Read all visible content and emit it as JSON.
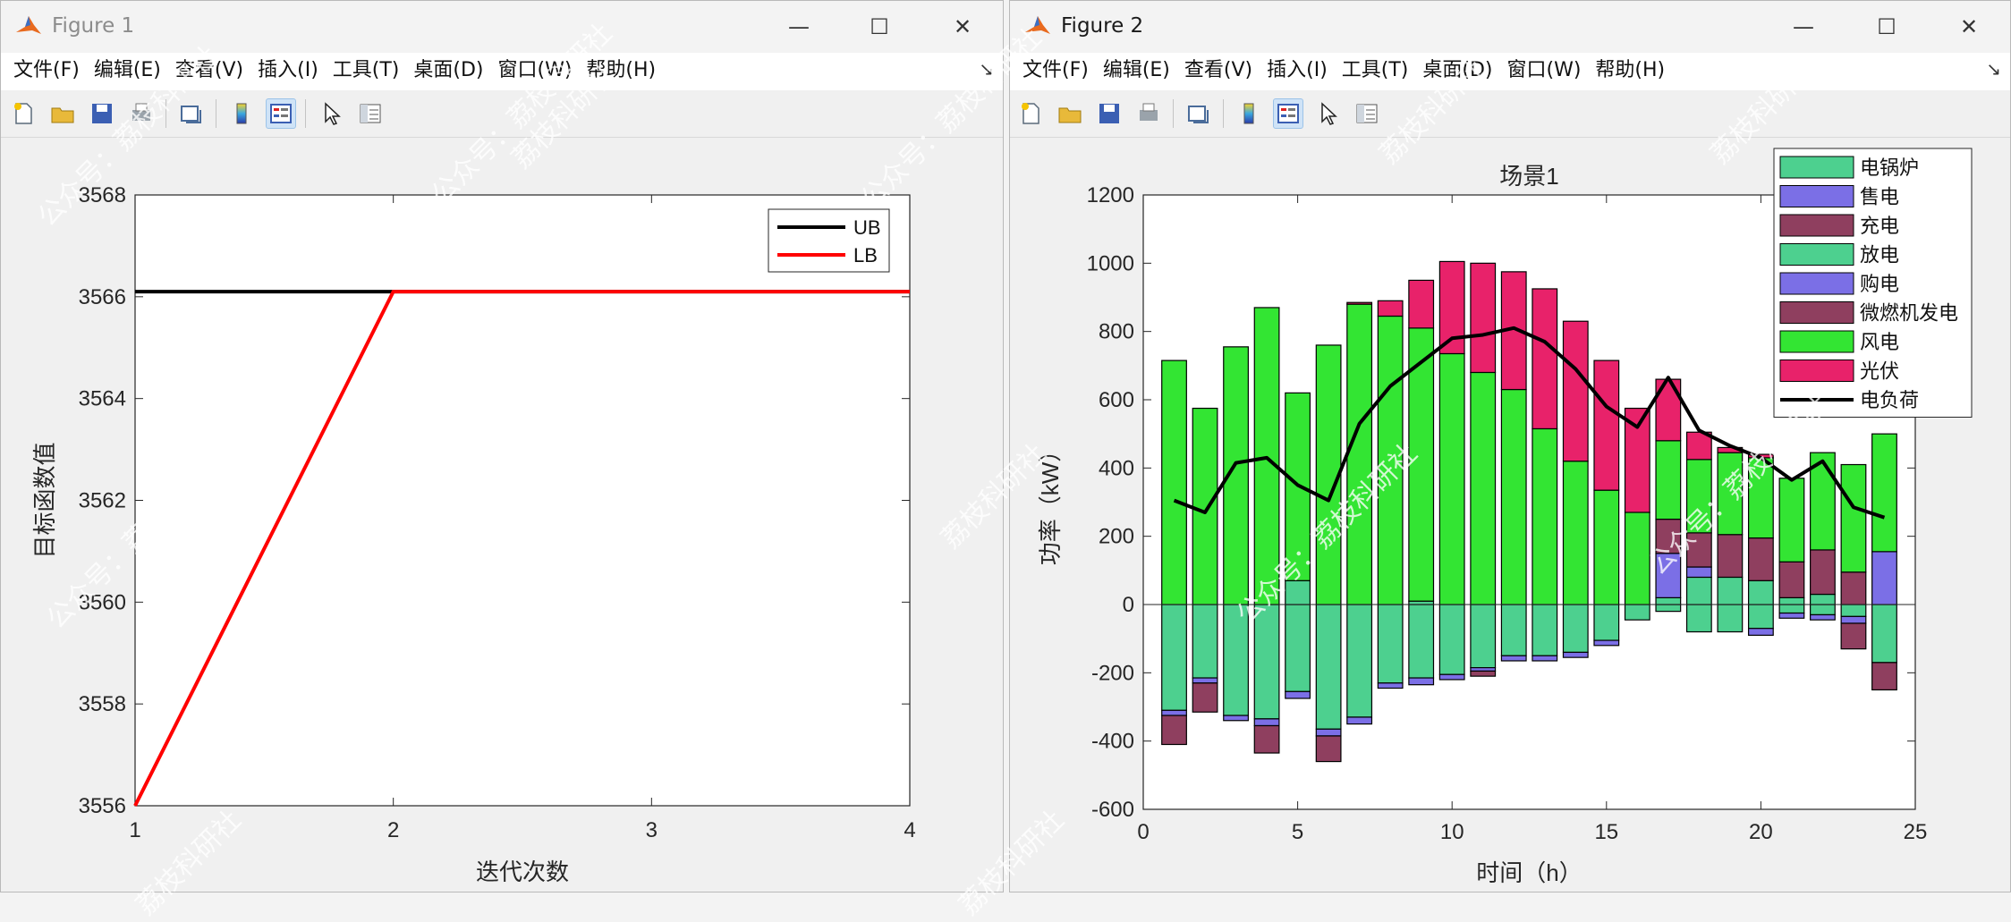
{
  "windows": [
    {
      "title": "Figure 1",
      "menus": [
        "文件(F)",
        "编辑(E)",
        "查看(V)",
        "插入(I)",
        "工具(T)",
        "桌面(D)",
        "窗口(W)",
        "帮助(H)"
      ]
    },
    {
      "title": "Figure 2",
      "menus": [
        "文件(F)",
        "编辑(E)",
        "查看(V)",
        "插入(I)",
        "工具(T)",
        "桌面(D)",
        "窗口(W)",
        "帮助(H)"
      ]
    }
  ],
  "window_buttons": {
    "minimize": "—",
    "maximize": "☐",
    "close": "✕"
  },
  "toolbar_icons": [
    "new-figure-icon",
    "open-file-icon",
    "save-figure-icon",
    "print-icon",
    "link-plot-icon",
    "insert-colorbar-icon",
    "insert-legend-icon",
    "edit-plot-icon",
    "property-inspector-icon"
  ],
  "watermarks": [
    "公众号：荔枝科研社",
    "荔枝科研社",
    "公众号：荔枝科研社",
    "荔枝科研社",
    "公众号：荔枝科研社",
    "荔枝科研社",
    "公众号：荔枝科研社",
    "荔枝科研社",
    "公众号：荔枝科研社",
    "荔枝科研社",
    "荔枝科研社",
    "荔枝科研社",
    "公众号：荔枝科研社"
  ],
  "chart_data": [
    {
      "type": "line",
      "title": "",
      "xlabel": "迭代次数",
      "ylabel": "目标函数值",
      "xlim": [
        1,
        4
      ],
      "ylim": [
        3556,
        3568
      ],
      "xticks": [
        1,
        2,
        3,
        4
      ],
      "yticks": [
        3556,
        3558,
        3560,
        3562,
        3564,
        3566,
        3568
      ],
      "series": [
        {
          "name": "UB",
          "x": [
            1,
            2,
            3,
            4
          ],
          "values": [
            3566.1,
            3566.1,
            3566.1,
            3566.1
          ],
          "color": "#000000"
        },
        {
          "name": "LB",
          "x": [
            1,
            2,
            3,
            4
          ],
          "values": [
            3556.0,
            3566.1,
            3566.1,
            3566.1
          ],
          "color": "#ff0000"
        }
      ],
      "legend_position": "top-right",
      "grid": false
    },
    {
      "type": "bar",
      "title": "场景1",
      "xlabel": "时间（h）",
      "ylabel": "功率（kW）",
      "xlim": [
        0,
        25
      ],
      "ylim": [
        -600,
        1200
      ],
      "xticks": [
        0,
        5,
        10,
        15,
        20,
        25
      ],
      "yticks": [
        -600,
        -400,
        -200,
        0,
        200,
        400,
        600,
        800,
        1000,
        1200
      ],
      "categories": [
        1,
        2,
        3,
        4,
        5,
        6,
        7,
        8,
        9,
        10,
        11,
        12,
        13,
        14,
        15,
        16,
        17,
        18,
        19,
        20,
        21,
        22,
        23,
        24
      ],
      "stacked": true,
      "series": [
        {
          "name": "电锅炉",
          "color": "#4dd08f",
          "values": [
            -310,
            -215,
            -325,
            -335,
            -255,
            -365,
            -330,
            -230,
            -215,
            -205,
            -185,
            -150,
            -150,
            -140,
            -105,
            -45,
            -20,
            -80,
            -80,
            -70,
            -25,
            -30,
            -35,
            -170
          ]
        },
        {
          "name": "售电",
          "color": "#7b6fe6",
          "values": [
            -15,
            -15,
            -15,
            -20,
            -20,
            -20,
            -20,
            -15,
            -20,
            -15,
            -10,
            -15,
            -15,
            -15,
            -15,
            0,
            0,
            0,
            0,
            -20,
            -15,
            -15,
            -20,
            0
          ]
        },
        {
          "name": "充电",
          "color": "#8f3f5f",
          "values": [
            -85,
            -85,
            0,
            -80,
            0,
            -75,
            0,
            0,
            0,
            0,
            -15,
            0,
            0,
            0,
            0,
            0,
            0,
            0,
            0,
            0,
            0,
            0,
            -75,
            -80
          ]
        },
        {
          "name": "放电",
          "color": "#4dd08f",
          "values": [
            0,
            0,
            0,
            0,
            70,
            0,
            0,
            0,
            10,
            0,
            0,
            0,
            0,
            0,
            0,
            0,
            20,
            80,
            80,
            70,
            20,
            30,
            0,
            0
          ]
        },
        {
          "name": "购电",
          "color": "#7b6fe6",
          "values": [
            0,
            0,
            0,
            0,
            0,
            0,
            0,
            0,
            0,
            0,
            0,
            0,
            0,
            0,
            0,
            0,
            130,
            30,
            0,
            0,
            0,
            0,
            0,
            155
          ]
        },
        {
          "name": "微燃机发电",
          "color": "#8f3f5f",
          "values": [
            0,
            0,
            0,
            0,
            0,
            0,
            0,
            0,
            0,
            0,
            0,
            0,
            0,
            0,
            0,
            0,
            100,
            100,
            125,
            125,
            105,
            130,
            95,
            0
          ]
        },
        {
          "name": "风电",
          "color": "#33e533",
          "values": [
            715,
            575,
            755,
            870,
            550,
            760,
            880,
            845,
            800,
            735,
            680,
            630,
            515,
            420,
            335,
            270,
            230,
            215,
            240,
            235,
            245,
            285,
            315,
            345
          ]
        },
        {
          "name": "光伏",
          "color": "#e8226a",
          "values": [
            0,
            0,
            0,
            0,
            0,
            0,
            5,
            45,
            140,
            270,
            320,
            345,
            410,
            410,
            380,
            305,
            180,
            80,
            15,
            10,
            0,
            0,
            0,
            0
          ]
        }
      ],
      "line_series": {
        "name": "电负荷",
        "color": "#000000",
        "values": [
          305,
          270,
          415,
          430,
          350,
          305,
          530,
          640,
          710,
          780,
          790,
          810,
          770,
          690,
          580,
          520,
          665,
          510,
          465,
          430,
          365,
          420,
          285,
          255
        ]
      },
      "legend_position": "top-right outside",
      "grid": false
    }
  ]
}
